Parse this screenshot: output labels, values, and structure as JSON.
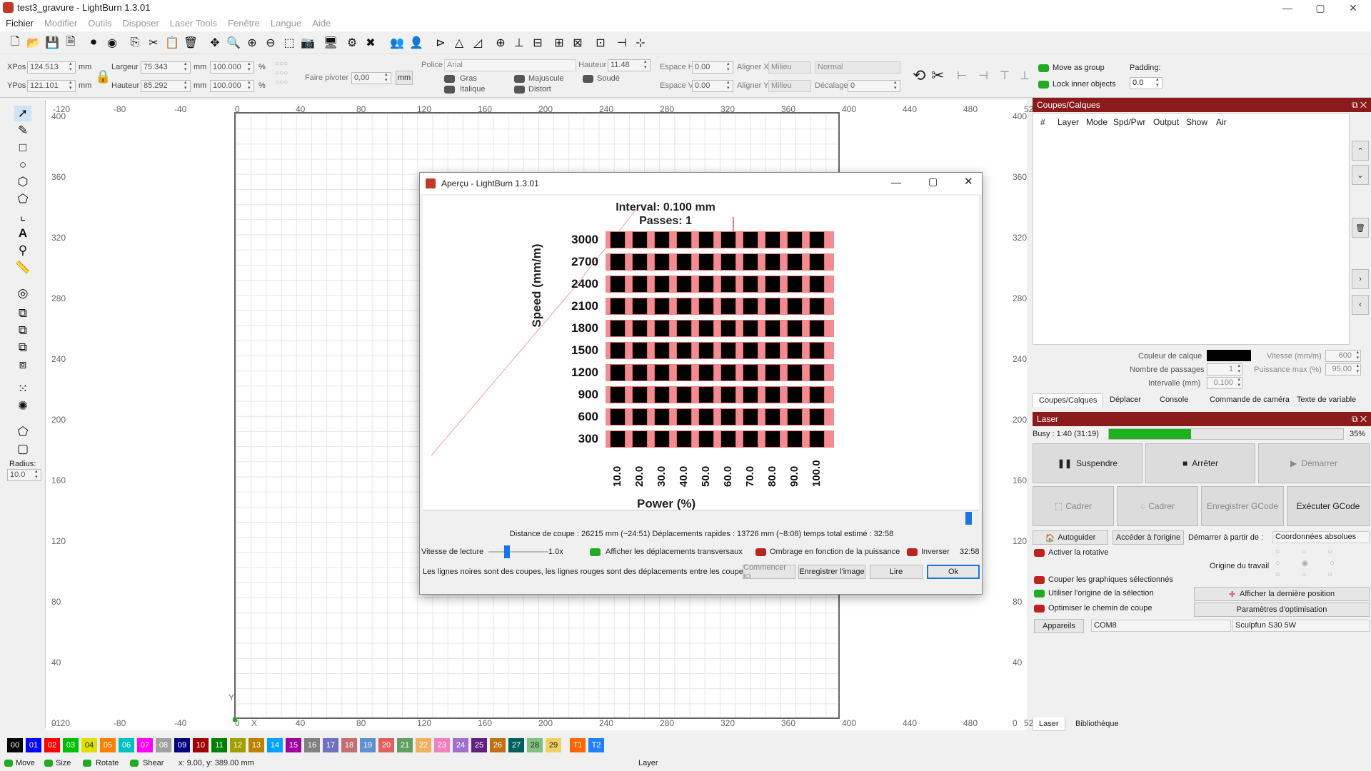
{
  "window": {
    "title": "test3_gravure - LightBurn 1.3.01",
    "min": "—",
    "max": "▢",
    "close": "✕"
  },
  "menu": [
    "Fichier",
    "Modifier",
    "Outils",
    "Disposer",
    "Laser Tools",
    "Fenêtre",
    "Langue",
    "Aide"
  ],
  "props": {
    "xpos_label": "XPos",
    "xpos": "124.513",
    "ypos_label": "YPos",
    "ypos": "121.101",
    "unit": "mm",
    "largeur_label": "Largeur",
    "largeur": "75.343",
    "hauteur_label": "Hauteur",
    "hauteur": "85.292",
    "pct1": "100.000",
    "pct2": "100.000",
    "pct": "%",
    "faire_pivoter": "Faire pivoter",
    "pivot": "0,00",
    "mm_btn": "mm",
    "police_label": "Police",
    "police": "Arial",
    "hauteur2_label": "Hauteur",
    "hauteur2": "11.48",
    "espace_h": "Espace H",
    "espace_h_val": "0.00",
    "espace_v": "Espace V",
    "espace_v_val": "0.00",
    "aligner_x": "Aligner X",
    "aligner_x_val": "Milieu",
    "aligner_y": "Aligner Y",
    "aligner_y_val": "Milieu",
    "normal": "Normal",
    "decalage": "Décalage",
    "decalage_val": "0",
    "gras": "Gras",
    "majuscule": "Majuscule",
    "soude": "Soudé",
    "italique": "Italique",
    "distort": "Distort",
    "move_group": "Move as group",
    "lock_inner": "Lock inner objects",
    "padding": "Padding:",
    "padding_val": "0.0"
  },
  "left": {
    "radius_label": "Radius:",
    "radius": "10.0"
  },
  "rulers": {
    "x": [
      "-120",
      "-80",
      "-40",
      "0",
      "40",
      "80",
      "120",
      "160",
      "200",
      "240",
      "280",
      "320",
      "360",
      "400",
      "440",
      "480",
      "520"
    ],
    "y": [
      "400",
      "360",
      "320",
      "280",
      "240",
      "200",
      "160",
      "120",
      "80",
      "40",
      "0"
    ],
    "y_axis": "Y",
    "x_axis": "X"
  },
  "cuts": {
    "header": "Coupes/Calques",
    "cols": [
      "#",
      "Layer",
      "Mode",
      "Spd/Pwr",
      "Output",
      "Show",
      "Air"
    ],
    "couleur_calque": "Couleur de calque",
    "vitesse": "Vitesse (mm/m)",
    "vitesse_val": "600",
    "passages": "Nombre de passages",
    "passages_val": "1",
    "puissance": "Puissance max (%)",
    "puissance_val": "95,00",
    "intervalle": "Intervalle (mm)",
    "intervalle_val": "0.100",
    "tabs": [
      "Coupes/Calques",
      "Déplacer",
      "Console",
      "Commande de caméra",
      "Texte de variable"
    ]
  },
  "laser": {
    "header": "Laser",
    "busy": "Busy : 1:40 (31:19)",
    "progress": 35,
    "progress_text": "35%",
    "suspendre": "Suspendre",
    "arreter": "Arrêter",
    "demarrer": "Démarrer",
    "cadrer1": "Cadrer",
    "cadrer2": "Cadrer",
    "enregistrer_gcode": "Enregistrer GCode",
    "executer_gcode": "Exécuter GCode",
    "autoguider": "Autoguider",
    "acceder": "Accéder à l'origine",
    "demarrer_depuis": "Démarrer à partir de :",
    "coords": "Coordonnées absolues",
    "activer_rotative": "Activer la rotative",
    "origine_travail": "Origine du travail",
    "couper_sel": "Couper les graphiques sélectionnés",
    "utiliser_origine": "Utiliser l'origine de la sélection",
    "afficher_derniere": "Afficher la dernière position",
    "optimiser": "Optimiser le chemin de coupe",
    "parametres_opt": "Paramètres d'optimisation",
    "appareils": "Appareils",
    "com": "COM8",
    "device": "Sculpfun S30 5W",
    "tabs": [
      "Laser",
      "Bibliothèque"
    ]
  },
  "palette": {
    "labels": [
      "00",
      "01",
      "02",
      "03",
      "04",
      "05",
      "06",
      "07",
      "08",
      "09",
      "10",
      "11",
      "12",
      "13",
      "14",
      "15",
      "16",
      "17",
      "18",
      "19",
      "20",
      "21",
      "22",
      "23",
      "24",
      "25",
      "26",
      "27",
      "28",
      "29",
      "T1",
      "T2"
    ],
    "colors": [
      "#000000",
      "#0000ff",
      "#ff0000",
      "#00c000",
      "#e0e000",
      "#ff8000",
      "#00c0c0",
      "#ff00ff",
      "#a0a0a0",
      "#000080",
      "#a00000",
      "#008000",
      "#a0a000",
      "#c08000",
      "#00a0ff",
      "#a000a0",
      "#808080",
      "#7070c0",
      "#c07070",
      "#6090d0",
      "#e06060",
      "#60a060",
      "#f0b060",
      "#f080c0",
      "#a070d0",
      "#602080",
      "#c07010",
      "#006060",
      "#80c080",
      "#f0d060",
      "#ff6600",
      "#2080ff"
    ],
    "dark_text": [
      "04",
      "28",
      "29"
    ]
  },
  "status": {
    "move": "Move",
    "size": "Size",
    "rotate": "Rotate",
    "shear": "Shear",
    "coords": "x: 9.00, y: 389.00 mm",
    "layer": "Layer"
  },
  "dialog": {
    "title": "Aperçu - LightBurn 1.3.01",
    "interval": "Interval:  0.100 mm",
    "passes": "Passes:  1",
    "speed_label": "Speed (mm/m)",
    "power_label": "Power (%)",
    "speeds": [
      "3000",
      "2700",
      "2400",
      "2100",
      "1800",
      "1500",
      "1200",
      "900",
      "600",
      "300"
    ],
    "powers": [
      "10.0",
      "20.0",
      "30.0",
      "40.0",
      "50.0",
      "60.0",
      "70.0",
      "80.0",
      "90.0",
      "100.0"
    ],
    "stats": "Distance de coupe : 26215 mm (~24:51)   Déplacements rapides : 13726 mm (~8:06)   temps total estimé : 32:58",
    "vitesse_lecture": "Vitesse de lecture",
    "speed_val": "1.0x",
    "afficher_deplacements": "Afficher les déplacements transversaux",
    "ombrage": "Ombrage en fonction de la puissance",
    "inverser": "Inverser",
    "time": "32:58",
    "legend": "Les lignes noires sont des coupes, les lignes rouges sont des déplacements entre les coupes",
    "commencer": "Commencer ici",
    "enregistrer": "Enregistrer l'image",
    "lire": "Lire",
    "ok": "Ok"
  }
}
